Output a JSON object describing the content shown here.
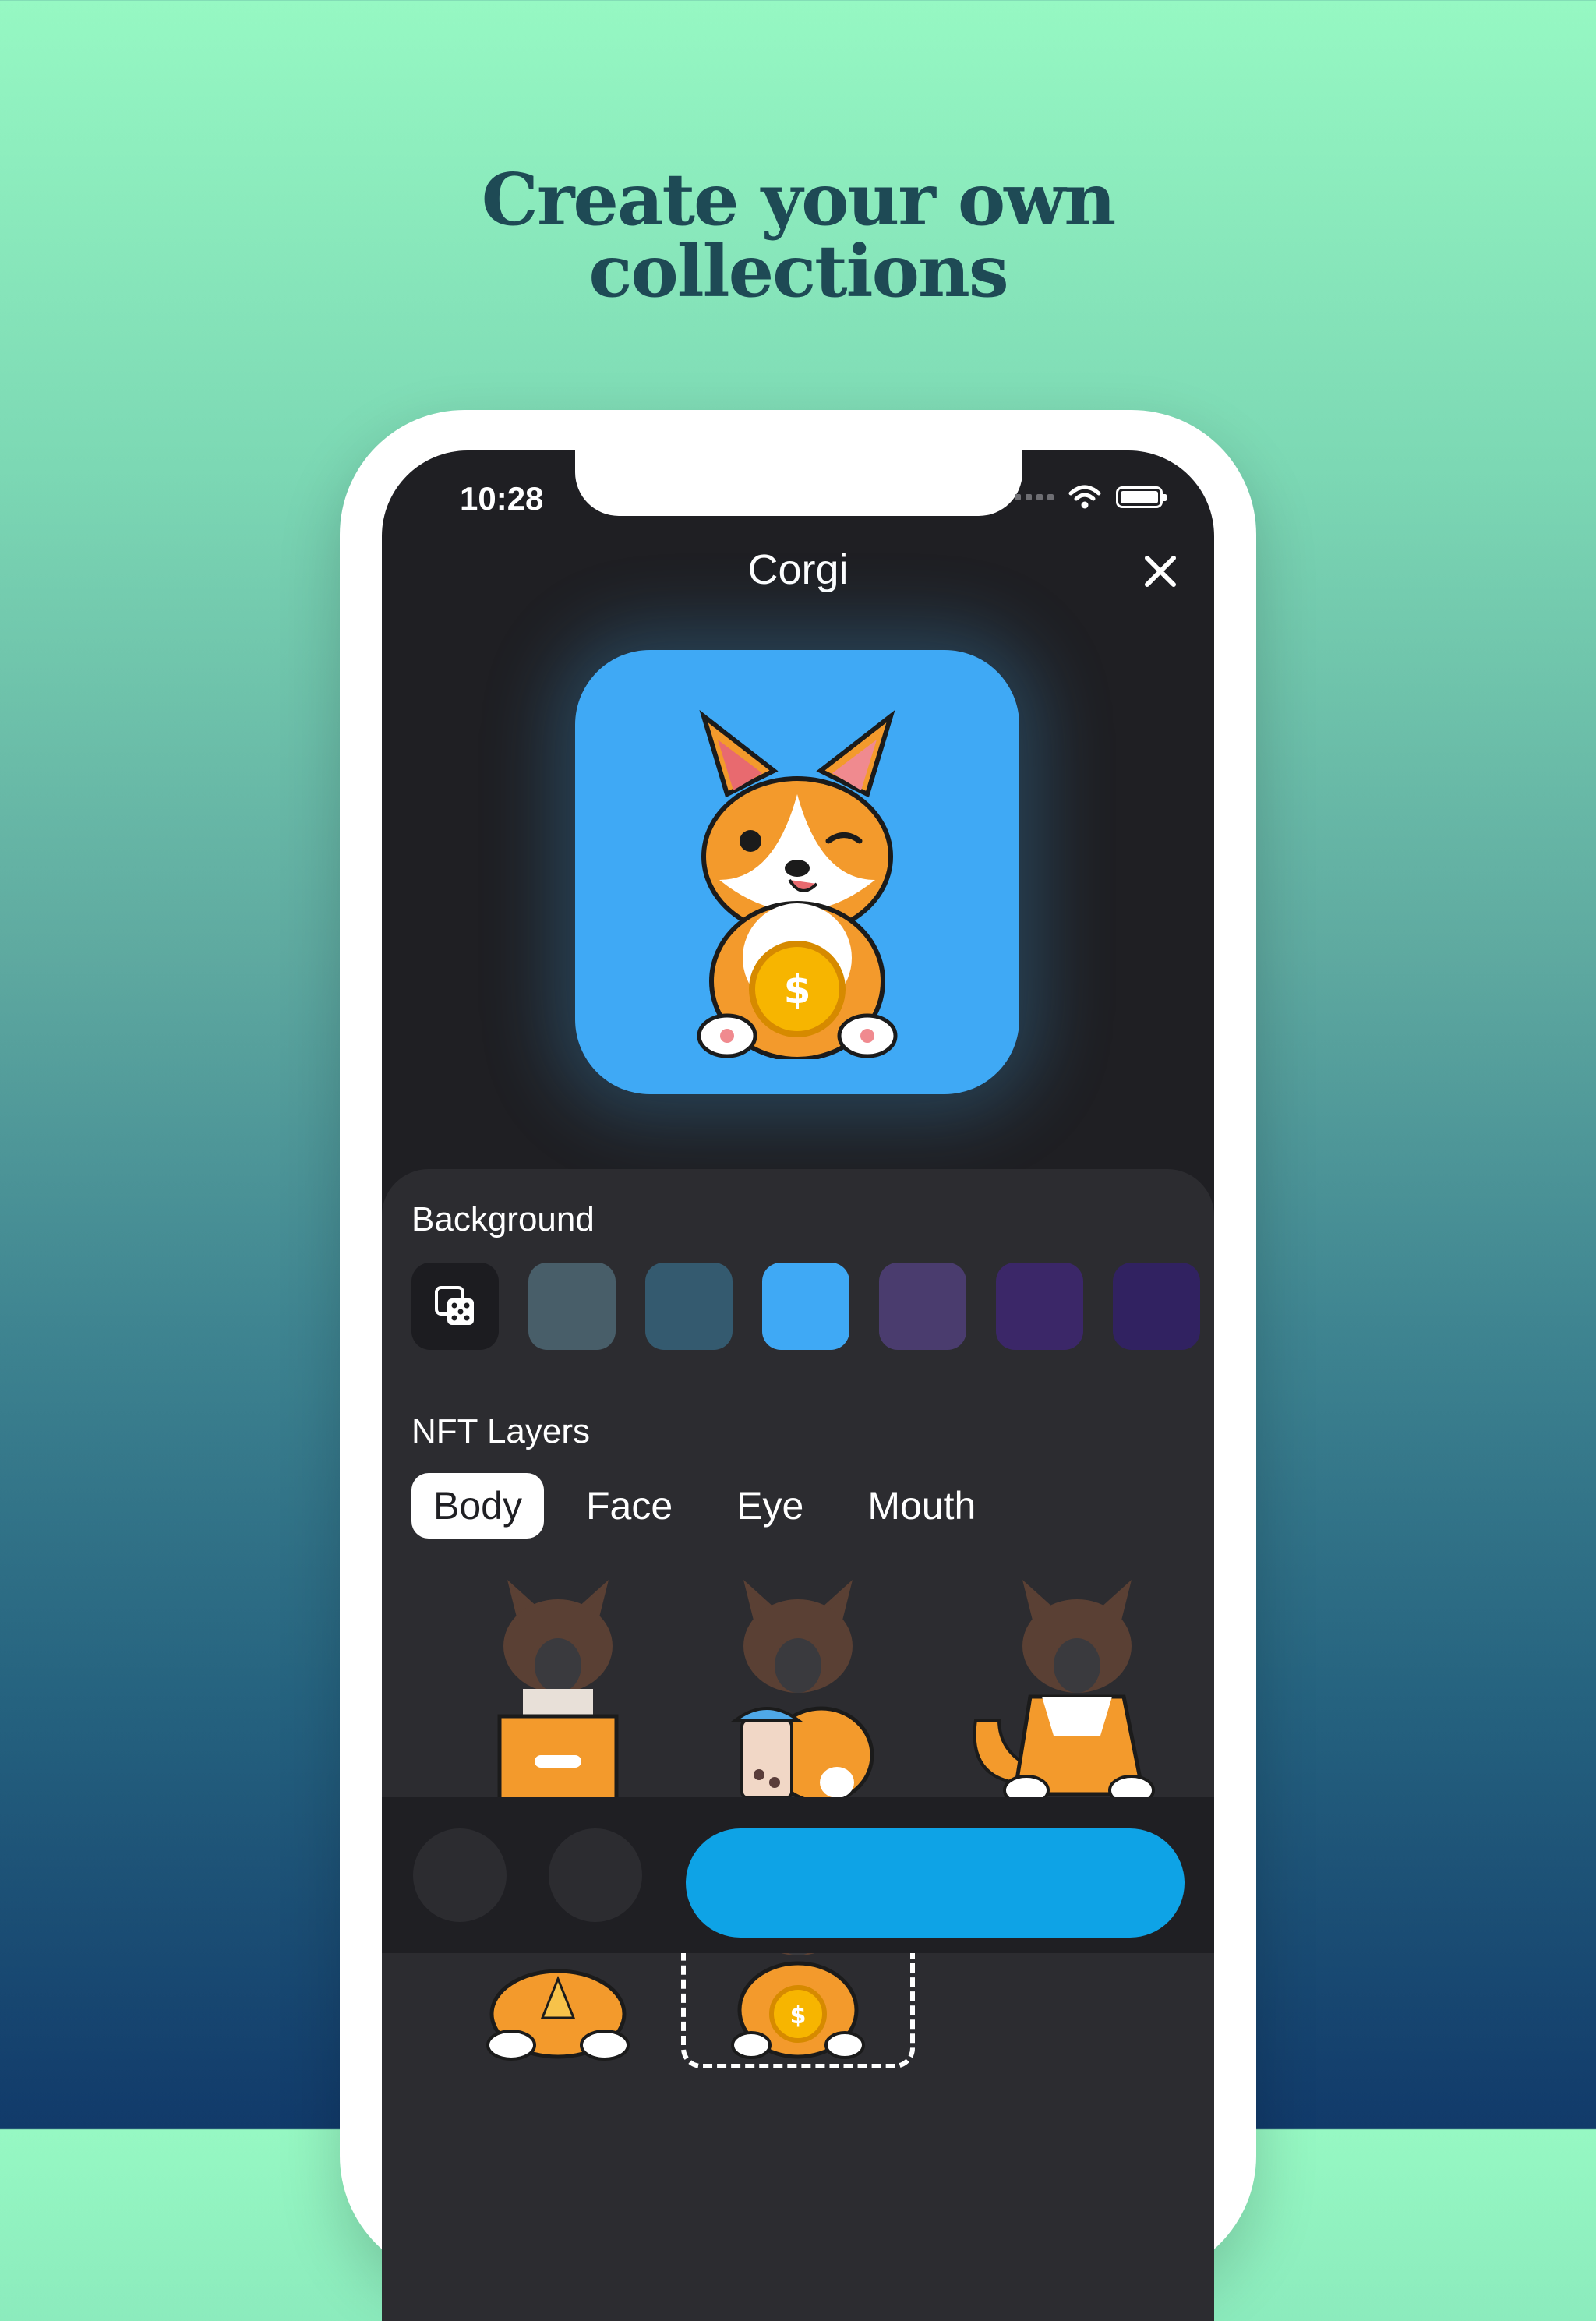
{
  "headline": {
    "line1": "Create your own",
    "line2": "collections"
  },
  "status_bar": {
    "time": "10:28"
  },
  "nav": {
    "title": "Corgi",
    "close_icon": "close-icon"
  },
  "preview": {
    "background_color": "#3fa9f5",
    "image": "corgi-holding-coin"
  },
  "background_section": {
    "label": "Background",
    "random_icon": "dice-icon",
    "swatches": [
      "#485e69",
      "#345a6f",
      "#3fa9f5",
      "#4a3c6e",
      "#3b2768",
      "#312261"
    ],
    "selected_index": 2
  },
  "layers_section": {
    "label": "NFT Layers",
    "tabs": [
      "Body",
      "Face",
      "Eye",
      "Mouth"
    ],
    "active_tab": "Body",
    "options": [
      "box-body",
      "boba-body",
      "sitting-body",
      "pizza-body",
      "coin-body"
    ],
    "selected_option": "coin-body"
  },
  "colors": {
    "accent": "#0ea3e6"
  }
}
